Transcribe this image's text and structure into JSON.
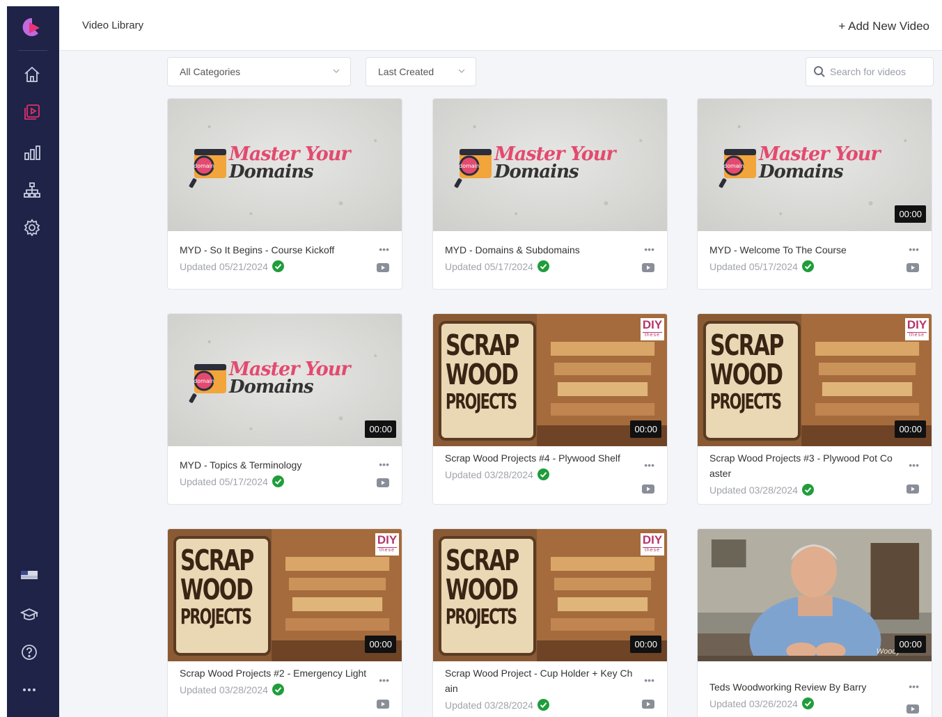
{
  "header": {
    "title": "Video Library",
    "add_button": "+ Add New Video"
  },
  "filters": {
    "category": "All Categories",
    "sort": "Last Created",
    "search_placeholder": "Search for videos"
  },
  "sidebar": {
    "items": [
      {
        "name": "home-icon",
        "active": false
      },
      {
        "name": "video-library-icon",
        "active": true
      },
      {
        "name": "analytics-icon",
        "active": false
      },
      {
        "name": "sitemap-icon",
        "active": false
      },
      {
        "name": "settings-icon",
        "active": false
      }
    ],
    "bottom": [
      "flag-icon",
      "graduation-cap-icon",
      "help-icon",
      "more-icon"
    ]
  },
  "thumbnail_text": {
    "myd_line1": "Master Your",
    "myd_line2": "Domains",
    "myd_icon_word": "domain",
    "sw_line1": "SCRAP",
    "sw_line2": "WOOD",
    "sw_line3": "PROJECTS",
    "diy_top": "DIY",
    "diy_bottom": "these",
    "woodworking_watermark": "Woody"
  },
  "card_ui": {
    "more": "•••"
  },
  "videos": [
    {
      "title": "MYD - So It Begins - Course Kickoff",
      "updated": "Updated 05/21/2024",
      "duration": "",
      "thumb": "myd"
    },
    {
      "title": "MYD - Domains & Subdomains",
      "updated": "Updated 05/17/2024",
      "duration": "",
      "thumb": "myd"
    },
    {
      "title": "MYD - Welcome To The Course",
      "updated": "Updated 05/17/2024",
      "duration": "00:00",
      "thumb": "myd"
    },
    {
      "title": "MYD - Topics & Terminology",
      "updated": "Updated 05/17/2024",
      "duration": "00:00",
      "thumb": "myd"
    },
    {
      "title": "Scrap Wood Projects #4 - Plywood Shelf",
      "updated": "Updated 03/28/2024",
      "duration": "00:00",
      "thumb": "scrap"
    },
    {
      "title": "Scrap Wood Projects #3 - Plywood Pot Coaster",
      "updated": "Updated 03/28/2024",
      "duration": "00:00",
      "thumb": "scrap"
    },
    {
      "title": "Scrap Wood Projects #2 - Emergency Light",
      "updated": "Updated 03/28/2024",
      "duration": "00:00",
      "thumb": "scrap"
    },
    {
      "title": "Scrap Wood Project - Cup Holder + Key Chain",
      "updated": "Updated 03/28/2024",
      "duration": "00:00",
      "thumb": "scrap"
    },
    {
      "title": "Teds Woodworking Review By Barry",
      "updated": "Updated 03/26/2024",
      "duration": "00:00",
      "thumb": "person"
    }
  ],
  "colors": {
    "sidebar": "#1e2347",
    "accent": "#e0306a",
    "check": "#1f9d3a"
  }
}
